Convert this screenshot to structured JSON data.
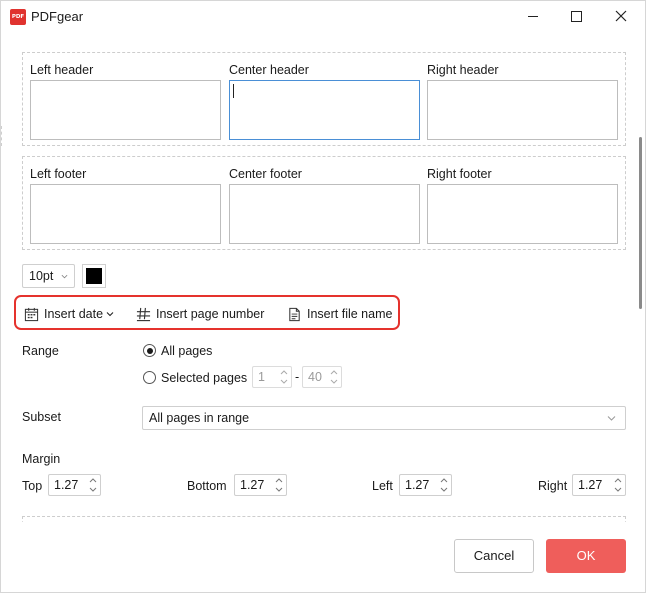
{
  "window": {
    "title": "PDFgear",
    "logo_text": "PDF",
    "accent_color": "#e5322d",
    "ok_color": "#ef5e5b"
  },
  "header": {
    "left_label": "Left header",
    "center_label": "Center header",
    "right_label": "Right header"
  },
  "footer": {
    "left_label": "Left footer",
    "center_label": "Center footer",
    "right_label": "Right footer"
  },
  "format": {
    "font_size": "10pt",
    "text_color": "#000000"
  },
  "insert": {
    "date_label": "Insert date",
    "page_number_label": "Insert page number",
    "file_name_label": "Insert file name"
  },
  "range": {
    "label": "Range",
    "all_pages_label": "All pages",
    "selected_pages_label": "Selected pages",
    "selected": "All pages",
    "from": "1",
    "separator": "-",
    "to": "40"
  },
  "subset": {
    "label": "Subset",
    "value": "All pages in range"
  },
  "margin": {
    "label": "Margin",
    "top_label": "Top",
    "top_value": "1.27",
    "bottom_label": "Bottom",
    "bottom_value": "1.27",
    "left_label": "Left",
    "left_value": "1.27",
    "right_label": "Right",
    "right_value": "1.27"
  },
  "buttons": {
    "cancel": "Cancel",
    "ok": "OK"
  }
}
